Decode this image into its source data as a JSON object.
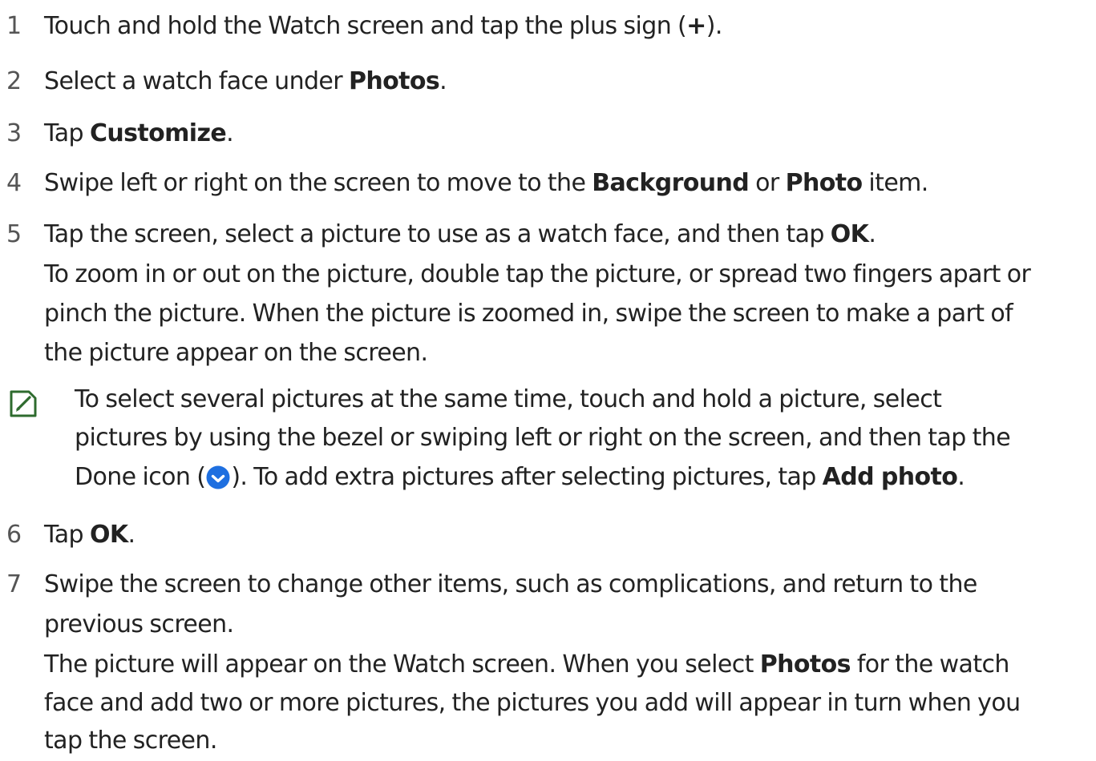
{
  "steps": [
    {
      "num": "1",
      "parts": [
        "Touch and hold the Watch screen and tap the plus sign (",
        "+",
        ")."
      ]
    },
    {
      "num": "2",
      "parts": [
        "Select a watch face under ",
        "Photos",
        "."
      ]
    },
    {
      "num": "3",
      "parts": [
        "Tap ",
        "Customize",
        "."
      ]
    },
    {
      "num": "4",
      "parts": [
        "Swipe left or right on the screen to move to the ",
        "Background",
        " or ",
        "Photo",
        " item."
      ]
    },
    {
      "num": "5",
      "parts": [
        "Tap the screen, select a picture to use as a watch face, and then tap ",
        "OK",
        "."
      ]
    },
    {
      "num": "6",
      "parts": [
        "Tap ",
        "OK",
        "."
      ]
    },
    {
      "num": "7",
      "line1": "Swipe the screen to change other items, such as complications, and return to the",
      "line2": "previous screen."
    }
  ],
  "step5_detail": [
    "To zoom in or out on the picture, double tap the picture, or spread two fingers apart or",
    "pinch the picture. When the picture is zoomed in, swipe the screen to make a part of",
    "the picture appear on the screen."
  ],
  "note": {
    "icon": "note-pencil-icon",
    "line1": "To select several pictures at the same time, touch and hold a picture, select",
    "line2": "pictures by using the bezel or swiping left or right on the screen, and then tap the",
    "line3_a": "Done icon (",
    "done_icon": "checkmark-circle-icon",
    "line3_b": "). To add extra pictures after selecting pictures, tap ",
    "line3_bold": "Add photo",
    "line3_c": "."
  },
  "step7_detail": {
    "line1_a": "The picture will appear on the Watch screen. When you select ",
    "line1_bold": "Photos",
    "line1_b": " for the watch",
    "line2": "face and add two or more pictures, the pictures you add will appear in turn when you",
    "line3": "tap the screen."
  },
  "colors": {
    "text": "#222222",
    "step_number": "#555555",
    "note_icon": "#2e6b2e",
    "done_icon": "#1e6fe0"
  }
}
